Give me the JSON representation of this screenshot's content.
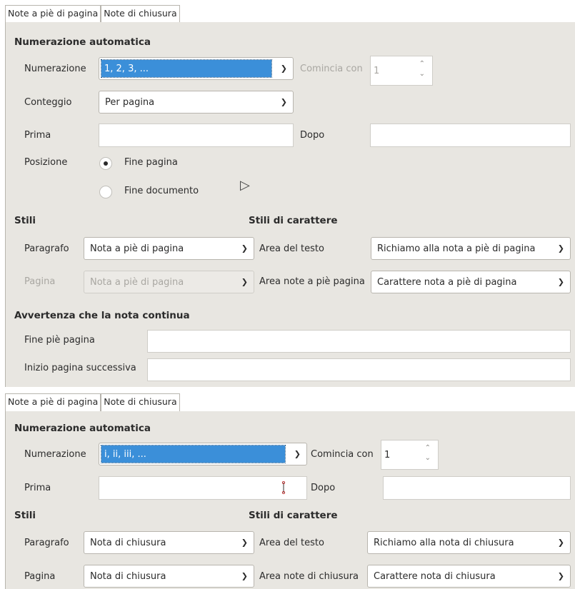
{
  "top": {
    "tabs": [
      "Note a piè di pagina",
      "Note di chiusura"
    ],
    "heading_numbering": "Numerazione automatica",
    "numbering_label": "Numerazione",
    "numbering_value": "1, 2, 3, ...",
    "start_label": "Comincia con",
    "start_value": "1",
    "counting_label": "Conteggio",
    "counting_value": "Per pagina",
    "before_label": "Prima",
    "after_label": "Dopo",
    "position_label": "Posizione",
    "position_options": [
      "Fine pagina",
      "Fine documento"
    ],
    "heading_styles": "Stili",
    "heading_char_styles": "Stili di carattere",
    "paragraph_label": "Paragrafo",
    "paragraph_value": "Nota a piè di pagina",
    "page_label": "Pagina",
    "page_value": "Nota a piè di pagina",
    "text_area_label": "Area del testo",
    "text_area_value": "Richiamo alla nota a piè di pagina",
    "notes_area_label": "Area note a piè pagina",
    "notes_area_value": "Carattere nota a piè di pagina",
    "heading_continuation": "Avvertenza che la nota continua",
    "end_of_footnote_label": "Fine piè pagina",
    "start_of_next_page_label": "Inizio pagina successiva"
  },
  "bottom": {
    "tabs": [
      "Note a piè di pagina",
      "Note di chiusura"
    ],
    "heading_numbering": "Numerazione automatica",
    "numbering_label": "Numerazione",
    "numbering_value": "i, ii, iii, ...",
    "start_label": "Comincia con",
    "start_value": "1",
    "before_label": "Prima",
    "after_label": "Dopo",
    "heading_styles": "Stili",
    "heading_char_styles": "Stili di carattere",
    "paragraph_label": "Paragrafo",
    "paragraph_value": "Nota di chiusura",
    "page_label": "Pagina",
    "page_value": "Nota di chiusura",
    "text_area_label": "Area del testo",
    "text_area_value": "Richiamo alla nota di chiusura",
    "notes_area_label": "Area note di chiusura",
    "notes_area_value": "Carattere nota di chiusura"
  },
  "icons": {
    "dropdown": "chevron-down-icon",
    "spin": "spin-arrows-icon",
    "pointer": "mouse-pointer-icon",
    "text_cursor": "text-cursor-icon"
  },
  "colors": {
    "selection": "#3b8fd9",
    "panel": "#e8e6e1"
  }
}
